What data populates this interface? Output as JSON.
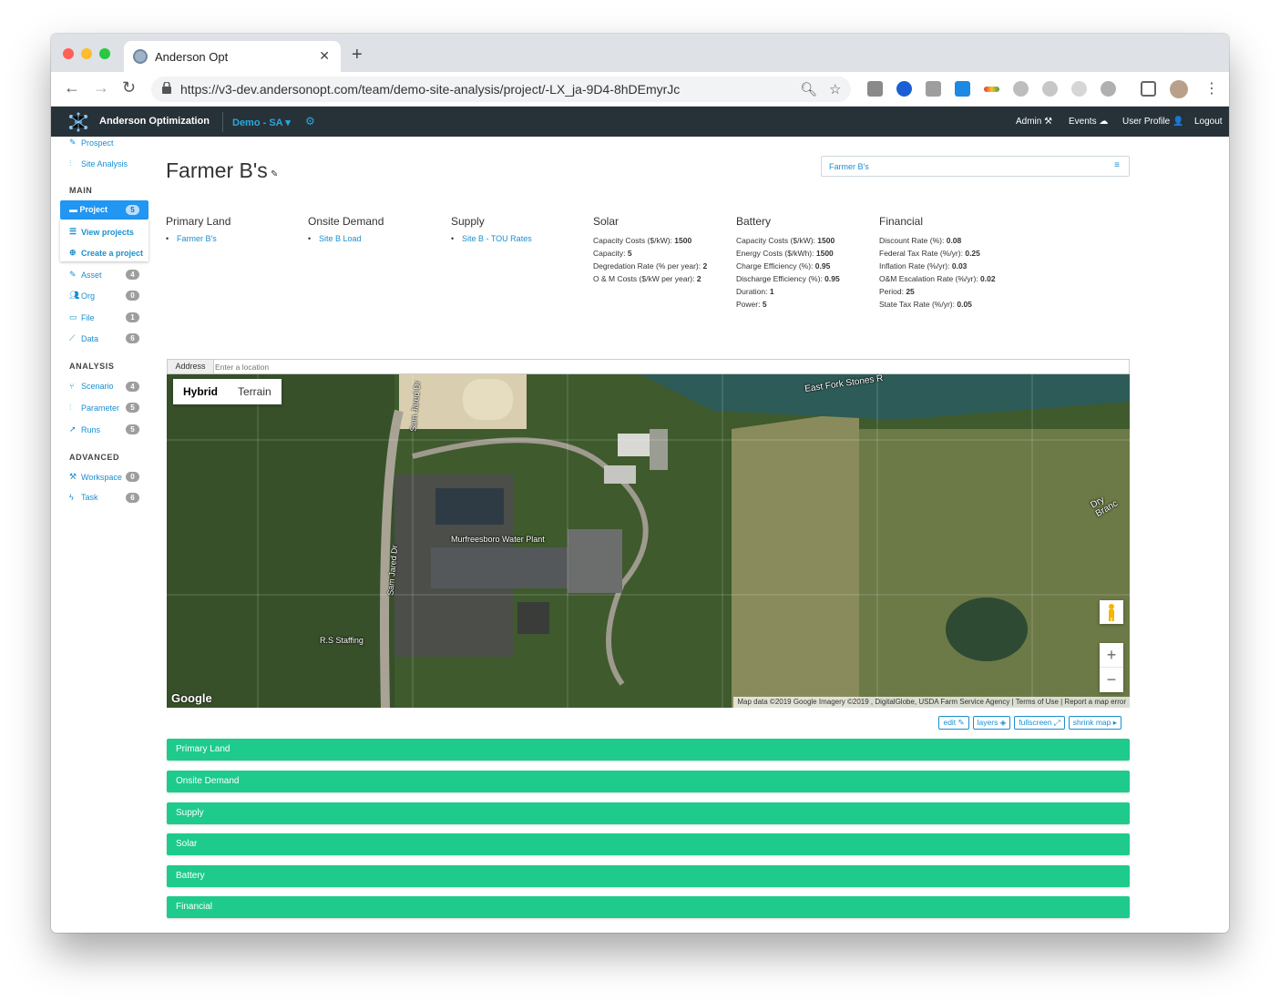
{
  "browser": {
    "tab_title": "Anderson Opt",
    "tab_close": "✕",
    "new_tab": "+",
    "url": "https://v3-dev.andersonopt.com/team/demo-site-analysis/project/-LX_ja-9D4-8hDEmyrJc"
  },
  "navbar": {
    "brand": "Anderson Optimization",
    "team": "Demo - SA",
    "admin": "Admin ⚒",
    "events": "Events ☁",
    "profile": "User Profile 👤",
    "logout": "Logout"
  },
  "sidebar": {
    "prospect": "Prospect",
    "site_analysis": "Site Analysis",
    "main_heading": "MAIN",
    "project": {
      "label": "Project",
      "count": "5"
    },
    "view_projects": "View projects",
    "create_project": "Create a project",
    "asset": {
      "label": "Asset",
      "count": "4"
    },
    "org": {
      "label": "Org",
      "count": "0"
    },
    "file": {
      "label": "File",
      "count": "1"
    },
    "data": {
      "label": "Data",
      "count": "6"
    },
    "analysis_heading": "ANALYSIS",
    "scenario": {
      "label": "Scenario",
      "count": "4"
    },
    "parameter": {
      "label": "Parameter",
      "count": "5"
    },
    "runs": {
      "label": "Runs",
      "count": "5"
    },
    "advanced_heading": "ADVANCED",
    "workspace": {
      "label": "Workspace",
      "count": "0"
    },
    "task": {
      "label": "Task",
      "count": "6"
    }
  },
  "page": {
    "title": "Farmer B's",
    "project_select": "Farmer B's",
    "menu_icon": "≡"
  },
  "summary": {
    "primary_land": {
      "heading": "Primary Land",
      "link": "Farmer B's"
    },
    "onsite_demand": {
      "heading": "Onsite Demand",
      "link": "Site B Load"
    },
    "supply": {
      "heading": "Supply",
      "link": "Site B - TOU Rates"
    },
    "solar": {
      "heading": "Solar",
      "rows": [
        {
          "k": "Capacity Costs ($/kW):",
          "v": "1500"
        },
        {
          "k": "Capacity:",
          "v": "5"
        },
        {
          "k": "Degredation Rate (% per year):",
          "v": "2"
        },
        {
          "k": "O & M Costs ($/kW per year):",
          "v": "2"
        }
      ]
    },
    "battery": {
      "heading": "Battery",
      "rows": [
        {
          "k": "Capacity Costs ($/kW):",
          "v": "1500"
        },
        {
          "k": "Energy Costs ($/kWh):",
          "v": "1500"
        },
        {
          "k": "Charge Efficiency (%):",
          "v": "0.95"
        },
        {
          "k": "Discharge Efficiency (%):",
          "v": "0.95"
        },
        {
          "k": "Duration:",
          "v": "1"
        },
        {
          "k": "Power:",
          "v": "5"
        }
      ]
    },
    "financial": {
      "heading": "Financial",
      "rows": [
        {
          "k": "Discount Rate (%):",
          "v": "0.08"
        },
        {
          "k": "Federal Tax Rate (%/yr):",
          "v": "0.25"
        },
        {
          "k": "Inflation Rate (%/yr):",
          "v": "0.03"
        },
        {
          "k": "O&M Escalation Rate (%/yr):",
          "v": "0.02"
        },
        {
          "k": "Period:",
          "v": "25"
        },
        {
          "k": "State Tax Rate (%/yr):",
          "v": "0.05"
        }
      ]
    }
  },
  "address": {
    "label": "Address",
    "placeholder": "Enter a location"
  },
  "map": {
    "hybrid": "Hybrid",
    "terrain": "Terrain",
    "zoom_in": "+",
    "zoom_out": "−",
    "google": "Google",
    "attribution": "Map data ©2019 Google Imagery ©2019 , DigitalGlobe, USDA Farm Service Agency | Terms of Use | Report a map error",
    "labels": {
      "water_plant": "Murfreesboro Water Plant",
      "staffing": "R.S Staffing",
      "road1": "Sam Jared Dr",
      "road2": "Sam Jared Dr",
      "river": "East Fork Stones R",
      "branch": "Dry Branc"
    }
  },
  "map_buttons": {
    "edit": "edit ✎",
    "layers": "layers ◈",
    "fullscreen": "fullscreen ⤢",
    "shrink": "shrink map ▸"
  },
  "panels": [
    "Primary Land",
    "Onsite Demand",
    "Supply",
    "Solar",
    "Battery",
    "Financial"
  ]
}
